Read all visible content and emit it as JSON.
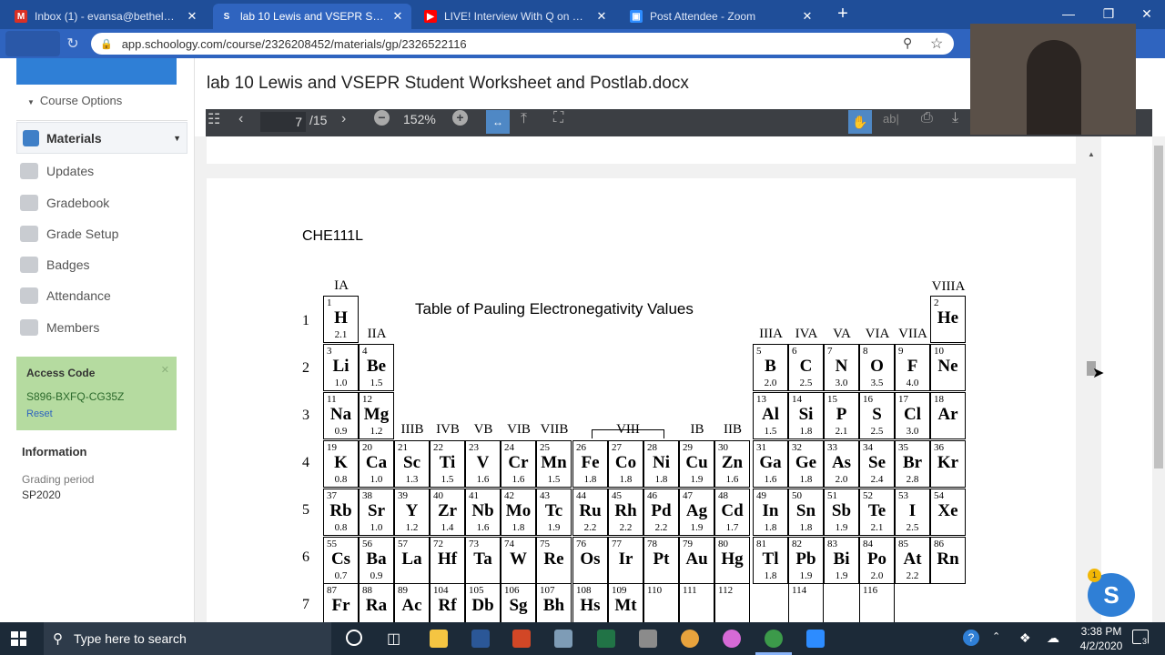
{
  "browser": {
    "tabs": [
      {
        "title": "Inbox (1) - evansa@bethelu.edu",
        "icon": "gmail-icon",
        "color": "#d93025",
        "glyph": "M"
      },
      {
        "title": "lab 10 Lewis and VSEPR Student",
        "icon": "schoology-icon",
        "color": "#2f64bf",
        "glyph": "S"
      },
      {
        "title": "LIVE! Interview With Q on Rights",
        "icon": "youtube-icon",
        "color": "#ff0000",
        "glyph": "▶"
      },
      {
        "title": "Post Attendee - Zoom",
        "icon": "zoom-icon",
        "color": "#2d8cff",
        "glyph": "▣"
      }
    ],
    "url": "app.schoology.com/course/2326208452/materials/gp/2326522116"
  },
  "sidebar": {
    "course_options": "Course Options",
    "materials": "Materials",
    "items": [
      {
        "label": "Updates",
        "icon": "updates-icon"
      },
      {
        "label": "Gradebook",
        "icon": "gradebook-icon"
      },
      {
        "label": "Grade Setup",
        "icon": "grade-setup-icon"
      },
      {
        "label": "Badges",
        "icon": "badges-icon"
      },
      {
        "label": "Attendance",
        "icon": "attendance-icon"
      },
      {
        "label": "Members",
        "icon": "members-icon"
      }
    ],
    "access_code_title": "Access Code",
    "access_code": "S896-BXFQ-CG35Z",
    "reset": "Reset",
    "information": "Information",
    "grading_period_label": "Grading period",
    "grading_period": "SP2020"
  },
  "document": {
    "title": "lab 10 Lewis and VSEPR Student Worksheet and Postlab.docx",
    "page_current": "7",
    "page_total": "/15",
    "zoom": "152%",
    "course_code": "CHE111L",
    "table_title": "Table of Pauling Electronegativity Values"
  },
  "periodic": {
    "groups": [
      "IA",
      "IIA",
      "IIIB",
      "IVB",
      "VB",
      "VIB",
      "VIIB",
      "VIII",
      "IB",
      "IIB",
      "IIIA",
      "IVA",
      "VA",
      "VIA",
      "VIIA",
      "VIIIA"
    ],
    "periods": [
      "1",
      "2",
      "3",
      "4",
      "5",
      "6",
      "7"
    ],
    "elements": [
      {
        "n": "1",
        "s": "H",
        "e": "2.1",
        "r": 1,
        "c": 1
      },
      {
        "n": "2",
        "s": "He",
        "e": "",
        "r": 1,
        "c": 18
      },
      {
        "n": "3",
        "s": "Li",
        "e": "1.0",
        "r": 2,
        "c": 1
      },
      {
        "n": "4",
        "s": "Be",
        "e": "1.5",
        "r": 2,
        "c": 2
      },
      {
        "n": "5",
        "s": "B",
        "e": "2.0",
        "r": 2,
        "c": 13
      },
      {
        "n": "6",
        "s": "C",
        "e": "2.5",
        "r": 2,
        "c": 14
      },
      {
        "n": "7",
        "s": "N",
        "e": "3.0",
        "r": 2,
        "c": 15
      },
      {
        "n": "8",
        "s": "O",
        "e": "3.5",
        "r": 2,
        "c": 16
      },
      {
        "n": "9",
        "s": "F",
        "e": "4.0",
        "r": 2,
        "c": 17
      },
      {
        "n": "10",
        "s": "Ne",
        "e": "",
        "r": 2,
        "c": 18
      },
      {
        "n": "11",
        "s": "Na",
        "e": "0.9",
        "r": 3,
        "c": 1
      },
      {
        "n": "12",
        "s": "Mg",
        "e": "1.2",
        "r": 3,
        "c": 2
      },
      {
        "n": "13",
        "s": "Al",
        "e": "1.5",
        "r": 3,
        "c": 13
      },
      {
        "n": "14",
        "s": "Si",
        "e": "1.8",
        "r": 3,
        "c": 14
      },
      {
        "n": "15",
        "s": "P",
        "e": "2.1",
        "r": 3,
        "c": 15
      },
      {
        "n": "16",
        "s": "S",
        "e": "2.5",
        "r": 3,
        "c": 16
      },
      {
        "n": "17",
        "s": "Cl",
        "e": "3.0",
        "r": 3,
        "c": 17
      },
      {
        "n": "18",
        "s": "Ar",
        "e": "",
        "r": 3,
        "c": 18
      },
      {
        "n": "19",
        "s": "K",
        "e": "0.8",
        "r": 4,
        "c": 1
      },
      {
        "n": "20",
        "s": "Ca",
        "e": "1.0",
        "r": 4,
        "c": 2
      },
      {
        "n": "21",
        "s": "Sc",
        "e": "1.3",
        "r": 4,
        "c": 3
      },
      {
        "n": "22",
        "s": "Ti",
        "e": "1.5",
        "r": 4,
        "c": 4
      },
      {
        "n": "23",
        "s": "V",
        "e": "1.6",
        "r": 4,
        "c": 5
      },
      {
        "n": "24",
        "s": "Cr",
        "e": "1.6",
        "r": 4,
        "c": 6
      },
      {
        "n": "25",
        "s": "Mn",
        "e": "1.5",
        "r": 4,
        "c": 7
      },
      {
        "n": "26",
        "s": "Fe",
        "e": "1.8",
        "r": 4,
        "c": 8
      },
      {
        "n": "27",
        "s": "Co",
        "e": "1.8",
        "r": 4,
        "c": 9
      },
      {
        "n": "28",
        "s": "Ni",
        "e": "1.8",
        "r": 4,
        "c": 10
      },
      {
        "n": "29",
        "s": "Cu",
        "e": "1.9",
        "r": 4,
        "c": 11
      },
      {
        "n": "30",
        "s": "Zn",
        "e": "1.6",
        "r": 4,
        "c": 12
      },
      {
        "n": "31",
        "s": "Ga",
        "e": "1.6",
        "r": 4,
        "c": 13
      },
      {
        "n": "32",
        "s": "Ge",
        "e": "1.8",
        "r": 4,
        "c": 14
      },
      {
        "n": "33",
        "s": "As",
        "e": "2.0",
        "r": 4,
        "c": 15
      },
      {
        "n": "34",
        "s": "Se",
        "e": "2.4",
        "r": 4,
        "c": 16
      },
      {
        "n": "35",
        "s": "Br",
        "e": "2.8",
        "r": 4,
        "c": 17
      },
      {
        "n": "36",
        "s": "Kr",
        "e": "",
        "r": 4,
        "c": 18
      },
      {
        "n": "37",
        "s": "Rb",
        "e": "0.8",
        "r": 5,
        "c": 1
      },
      {
        "n": "38",
        "s": "Sr",
        "e": "1.0",
        "r": 5,
        "c": 2
      },
      {
        "n": "39",
        "s": "Y",
        "e": "1.2",
        "r": 5,
        "c": 3
      },
      {
        "n": "40",
        "s": "Zr",
        "e": "1.4",
        "r": 5,
        "c": 4
      },
      {
        "n": "41",
        "s": "Nb",
        "e": "1.6",
        "r": 5,
        "c": 5
      },
      {
        "n": "42",
        "s": "Mo",
        "e": "1.8",
        "r": 5,
        "c": 6
      },
      {
        "n": "43",
        "s": "Tc",
        "e": "1.9",
        "r": 5,
        "c": 7
      },
      {
        "n": "44",
        "s": "Ru",
        "e": "2.2",
        "r": 5,
        "c": 8
      },
      {
        "n": "45",
        "s": "Rh",
        "e": "2.2",
        "r": 5,
        "c": 9
      },
      {
        "n": "46",
        "s": "Pd",
        "e": "2.2",
        "r": 5,
        "c": 10
      },
      {
        "n": "47",
        "s": "Ag",
        "e": "1.9",
        "r": 5,
        "c": 11
      },
      {
        "n": "48",
        "s": "Cd",
        "e": "1.7",
        "r": 5,
        "c": 12
      },
      {
        "n": "49",
        "s": "In",
        "e": "1.8",
        "r": 5,
        "c": 13
      },
      {
        "n": "50",
        "s": "Sn",
        "e": "1.8",
        "r": 5,
        "c": 14
      },
      {
        "n": "51",
        "s": "Sb",
        "e": "1.9",
        "r": 5,
        "c": 15
      },
      {
        "n": "52",
        "s": "Te",
        "e": "2.1",
        "r": 5,
        "c": 16
      },
      {
        "n": "53",
        "s": "I",
        "e": "2.5",
        "r": 5,
        "c": 17
      },
      {
        "n": "54",
        "s": "Xe",
        "e": "",
        "r": 5,
        "c": 18
      },
      {
        "n": "55",
        "s": "Cs",
        "e": "0.7",
        "r": 6,
        "c": 1
      },
      {
        "n": "56",
        "s": "Ba",
        "e": "0.9",
        "r": 6,
        "c": 2
      },
      {
        "n": "57",
        "s": "La",
        "e": "",
        "r": 6,
        "c": 3
      },
      {
        "n": "72",
        "s": "Hf",
        "e": "",
        "r": 6,
        "c": 4
      },
      {
        "n": "73",
        "s": "Ta",
        "e": "",
        "r": 6,
        "c": 5
      },
      {
        "n": "74",
        "s": "W",
        "e": "",
        "r": 6,
        "c": 6
      },
      {
        "n": "75",
        "s": "Re",
        "e": "",
        "r": 6,
        "c": 7
      },
      {
        "n": "76",
        "s": "Os",
        "e": "",
        "r": 6,
        "c": 8
      },
      {
        "n": "77",
        "s": "Ir",
        "e": "",
        "r": 6,
        "c": 9
      },
      {
        "n": "78",
        "s": "Pt",
        "e": "",
        "r": 6,
        "c": 10
      },
      {
        "n": "79",
        "s": "Au",
        "e": "",
        "r": 6,
        "c": 11
      },
      {
        "n": "80",
        "s": "Hg",
        "e": "",
        "r": 6,
        "c": 12
      },
      {
        "n": "81",
        "s": "Tl",
        "e": "1.8",
        "r": 6,
        "c": 13
      },
      {
        "n": "82",
        "s": "Pb",
        "e": "1.9",
        "r": 6,
        "c": 14
      },
      {
        "n": "83",
        "s": "Bi",
        "e": "1.9",
        "r": 6,
        "c": 15
      },
      {
        "n": "84",
        "s": "Po",
        "e": "2.0",
        "r": 6,
        "c": 16
      },
      {
        "n": "85",
        "s": "At",
        "e": "2.2",
        "r": 6,
        "c": 17
      },
      {
        "n": "86",
        "s": "Rn",
        "e": "",
        "r": 6,
        "c": 18
      },
      {
        "n": "87",
        "s": "Fr",
        "e": "",
        "r": 7,
        "c": 1
      },
      {
        "n": "88",
        "s": "Ra",
        "e": "",
        "r": 7,
        "c": 2
      },
      {
        "n": "89",
        "s": "Ac",
        "e": "",
        "r": 7,
        "c": 3
      },
      {
        "n": "104",
        "s": "Rf",
        "e": "",
        "r": 7,
        "c": 4
      },
      {
        "n": "105",
        "s": "Db",
        "e": "",
        "r": 7,
        "c": 5
      },
      {
        "n": "106",
        "s": "Sg",
        "e": "",
        "r": 7,
        "c": 6
      },
      {
        "n": "107",
        "s": "Bh",
        "e": "",
        "r": 7,
        "c": 7
      },
      {
        "n": "108",
        "s": "Hs",
        "e": "",
        "r": 7,
        "c": 8
      },
      {
        "n": "109",
        "s": "Mt",
        "e": "",
        "r": 7,
        "c": 9
      },
      {
        "n": "110",
        "s": "",
        "e": "",
        "r": 7,
        "c": 10
      },
      {
        "n": "111",
        "s": "",
        "e": "",
        "r": 7,
        "c": 11
      },
      {
        "n": "112",
        "s": "",
        "e": "",
        "r": 7,
        "c": 12
      },
      {
        "n": "114",
        "s": "",
        "e": "",
        "r": 7,
        "c": 14
      },
      {
        "n": "116",
        "s": "",
        "e": "",
        "r": 7,
        "c": 16
      }
    ]
  },
  "taskbar": {
    "search_placeholder": "Type here to search",
    "time": "3:38 PM",
    "date": "4/2/2020",
    "notifications": "3"
  },
  "chat": {
    "badge": "1",
    "letter": "S"
  }
}
